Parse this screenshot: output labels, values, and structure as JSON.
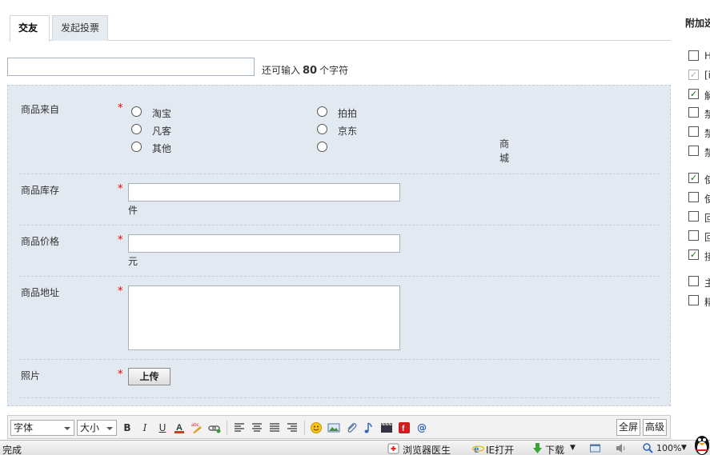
{
  "tabs": [
    {
      "label": "交友",
      "active": true
    },
    {
      "label": "发起投票",
      "active": false
    }
  ],
  "subject": {
    "value": "",
    "hint_prefix": "还可输入",
    "hint_count": "80",
    "hint_suffix": "个字符"
  },
  "form": {
    "source": {
      "label": "商品来自",
      "required": "*",
      "options": [
        "淘宝",
        "拍拍",
        "凡客",
        "京东",
        "其他",
        ""
      ],
      "selected": null,
      "mall_text": "商城"
    },
    "stock": {
      "label": "商品库存",
      "required": "*",
      "value": "",
      "unit": "件"
    },
    "price": {
      "label": "商品价格",
      "required": "*",
      "value": "",
      "unit": "元"
    },
    "address": {
      "label": "商品地址",
      "required": "*",
      "value": ""
    },
    "photo": {
      "label": "照片",
      "required": "*",
      "upload_label": "上传"
    }
  },
  "toolbar": {
    "font_select": "字体",
    "size_select": "大小",
    "bold": "B",
    "italic": "I",
    "underline": "U",
    "fullscreen": "全屏",
    "advanced": "高级",
    "icons": [
      "font-color-icon",
      "highlight-icon",
      "link-icon",
      "align-left-icon",
      "align-center-icon",
      "align-justify-icon",
      "align-right-icon",
      "smiley-icon",
      "image-icon",
      "attachment-icon",
      "music-icon",
      "video-icon",
      "flash-icon",
      "at-icon"
    ]
  },
  "sidebar": {
    "title": "附加选",
    "options": [
      {
        "label": "H",
        "checked": false,
        "disabled": false
      },
      {
        "label": "[i",
        "checked": true,
        "disabled": true
      },
      {
        "label": "解",
        "checked": true,
        "disabled": false
      },
      {
        "label": "禁",
        "checked": false,
        "disabled": false
      },
      {
        "label": "禁",
        "checked": false,
        "disabled": false
      },
      {
        "label": "禁",
        "checked": false,
        "disabled": false
      },
      {
        "label": "使",
        "checked": true,
        "disabled": false
      },
      {
        "label": "使",
        "checked": false,
        "disabled": false
      },
      {
        "label": "回",
        "checked": false,
        "disabled": false
      },
      {
        "label": "回",
        "checked": false,
        "disabled": false
      },
      {
        "label": "接",
        "checked": true,
        "disabled": false
      },
      {
        "label": "主",
        "checked": false,
        "disabled": false
      },
      {
        "label": "精",
        "checked": false,
        "disabled": false
      }
    ]
  },
  "statusbar": {
    "status": "完成",
    "doctor": "浏览器医生",
    "ie_open": "IE打开",
    "download": "下载",
    "zoom": "100%"
  },
  "colors": {
    "panel_bg": "#e3e9f0",
    "required": "#ee0000",
    "check": "#1a6e1a"
  }
}
